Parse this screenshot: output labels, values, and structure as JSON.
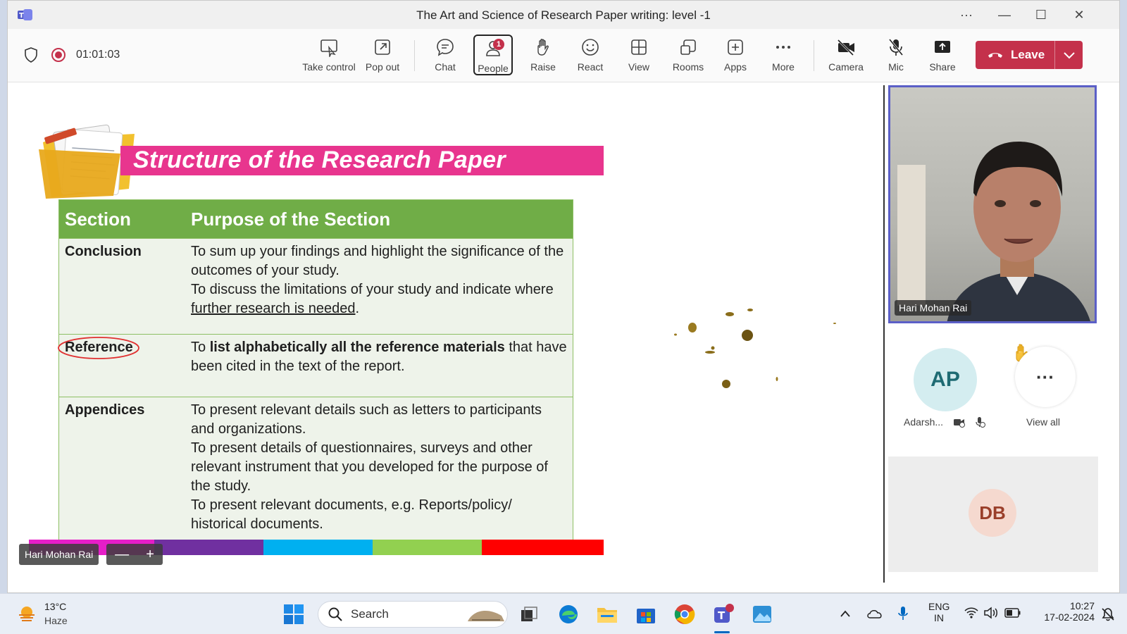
{
  "window": {
    "title": "The Art and Science of Research Paper writing: level -1",
    "controls": [
      "···",
      "—",
      "☐",
      "✕"
    ]
  },
  "toolbar": {
    "timer": "01:01:03",
    "buttons": [
      {
        "label": "Take control",
        "icon": "take-control-icon"
      },
      {
        "label": "Pop out",
        "icon": "pop-out-icon"
      },
      {
        "label": "Chat",
        "icon": "chat-icon"
      },
      {
        "label": "People",
        "icon": "people-icon",
        "badge": "1"
      },
      {
        "label": "Raise",
        "icon": "raise-hand-icon"
      },
      {
        "label": "React",
        "icon": "react-icon"
      },
      {
        "label": "View",
        "icon": "view-icon"
      },
      {
        "label": "Rooms",
        "icon": "rooms-icon"
      },
      {
        "label": "Apps",
        "icon": "apps-icon"
      },
      {
        "label": "More",
        "icon": "more-icon"
      },
      {
        "label": "Camera",
        "icon": "camera-off-icon"
      },
      {
        "label": "Mic",
        "icon": "mic-off-icon"
      },
      {
        "label": "Share",
        "icon": "share-icon"
      }
    ],
    "leave_label": "Leave",
    "accent": "#c4314b"
  },
  "slide": {
    "title": "Structure of the Research Paper",
    "header": {
      "c1": "Section",
      "c2": "Purpose of the Section"
    },
    "rows": [
      {
        "section": "Conclusion",
        "lines": [
          "To sum up your findings and highlight the significance of the outcomes of your study.",
          "To discuss the limitations of your study and indicate where ",
          "further research is needed",
          "."
        ]
      },
      {
        "section": "Reference",
        "parts": [
          "To ",
          "list alphabetically all the reference materials",
          " that have been cited in the text of the report."
        ]
      },
      {
        "section": "Appendices",
        "lines": [
          "To present relevant details such as letters to participants and organizations.",
          "To present details of questionnaires, surveys and other relevant instrument that you developed for the purpose of the study.",
          "To present relevant documents, e.g. Reports/policy/ historical documents."
        ]
      }
    ],
    "colors": {
      "banner": "#e8358e",
      "header": "#70ad47"
    },
    "colorbar": [
      "#e61ec8",
      "#7030a0",
      "#00b0f0",
      "#92d050",
      "#ff0000"
    ]
  },
  "stage": {
    "presenter_name": "Hari Mohan Rai",
    "zoom_out": "—",
    "zoom_in": "+"
  },
  "participants": {
    "main_video_name": "Hari Mohan Rai",
    "ap": {
      "initials": "AP",
      "name": "Adarsh..."
    },
    "view_all": "View all",
    "db": {
      "initials": "DB"
    }
  },
  "taskbar": {
    "temp": "13°C",
    "condition": "Haze",
    "search_placeholder": "Search",
    "lang_top": "ENG",
    "lang_bottom": "IN",
    "time": "10:27",
    "date": "17-02-2024"
  }
}
